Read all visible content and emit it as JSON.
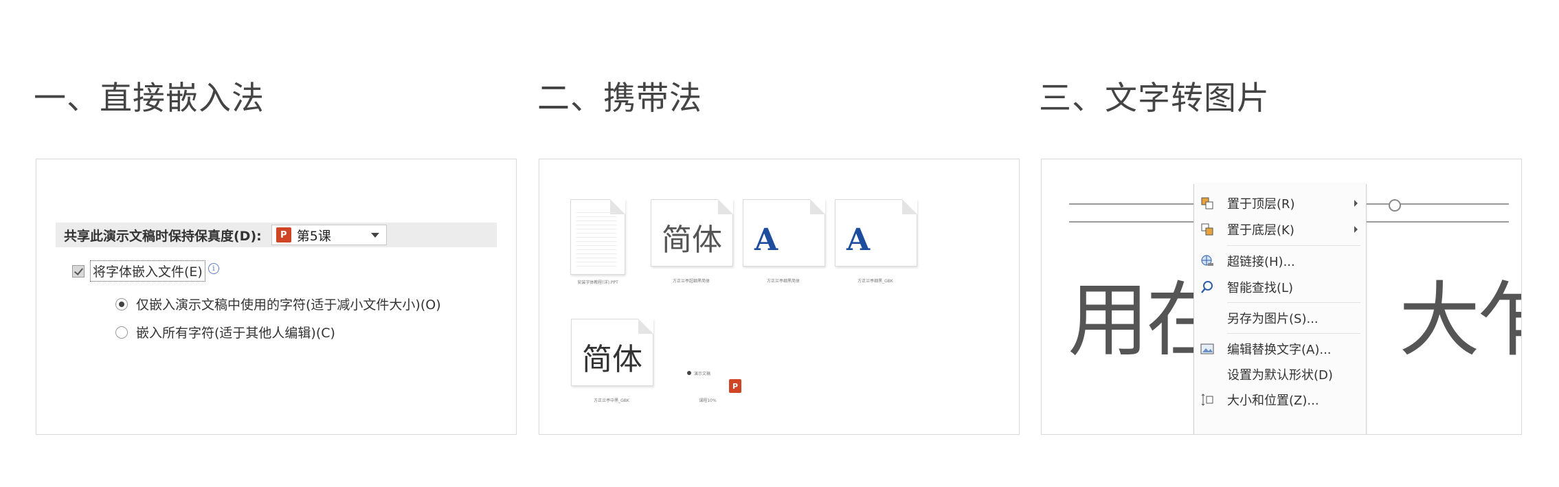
{
  "sections": {
    "embed": {
      "heading": "一、直接嵌入法"
    },
    "carry": {
      "heading": "二、携带法"
    },
    "convert": {
      "heading": "三、文字转图片"
    }
  },
  "embed_panel": {
    "share_label": "共享此演示文稿时保持保真度(D):",
    "dropdown_value": "第5课",
    "dropdown_icon": "powerpoint-icon",
    "ppt_glyph": "P",
    "checkbox_label": "将字体嵌入文件(E)",
    "checkbox_checked": true,
    "info_glyph": "i",
    "radio_options": [
      {
        "label": "仅嵌入演示文稿中使用的字符(适于减小文件大小)(O)",
        "selected": true
      },
      {
        "label": "嵌入所有字符(适于其他人编辑)(C)",
        "selected": false
      }
    ]
  },
  "carry_panel": {
    "files": [
      {
        "preview": "",
        "caption": "安装字体教程(详).PPT",
        "icon": "document-icon"
      },
      {
        "preview": "简体",
        "caption": "方正兰亭超细黑简体",
        "icon": "font-file-icon"
      },
      {
        "preview": "A",
        "caption": "方正兰亭细黑简体",
        "icon": "font-file-icon"
      },
      {
        "preview": "A",
        "caption": "方正兰亭细黑_GBK",
        "icon": "font-file-icon"
      },
      {
        "preview": "简体",
        "caption": "方正兰亭中黑_GBK",
        "icon": "font-file-icon"
      },
      {
        "preview": "",
        "caption": "课程10%",
        "icon": "powerpoint-icon"
      }
    ],
    "extra_caption": "演示文稿"
  },
  "convert_panel": {
    "big_text_left": "用在",
    "big_text_right": "大乍",
    "menu_items": [
      {
        "label": "置于顶层(R)",
        "icon": "bring-to-front-icon",
        "submenu": true
      },
      {
        "label": "置于底层(K)",
        "icon": "send-to-back-icon",
        "submenu": true
      },
      {
        "label": "超链接(H)...",
        "icon": "hyperlink-globe-icon",
        "submenu": false
      },
      {
        "label": "智能查找(L)",
        "icon": "smart-lookup-icon",
        "submenu": false
      },
      {
        "label": "另存为图片(S)...",
        "icon": "",
        "submenu": false
      },
      {
        "label": "编辑替换文字(A)...",
        "icon": "alt-text-icon",
        "submenu": false
      },
      {
        "label": "设置为默认形状(D)",
        "icon": "",
        "submenu": false
      },
      {
        "label": "大小和位置(Z)...",
        "icon": "size-position-icon",
        "submenu": false
      }
    ]
  },
  "colors": {
    "ppt_red": "#d04525",
    "font_blue": "#1d4d9c",
    "info_blue": "#5b7fc7"
  }
}
